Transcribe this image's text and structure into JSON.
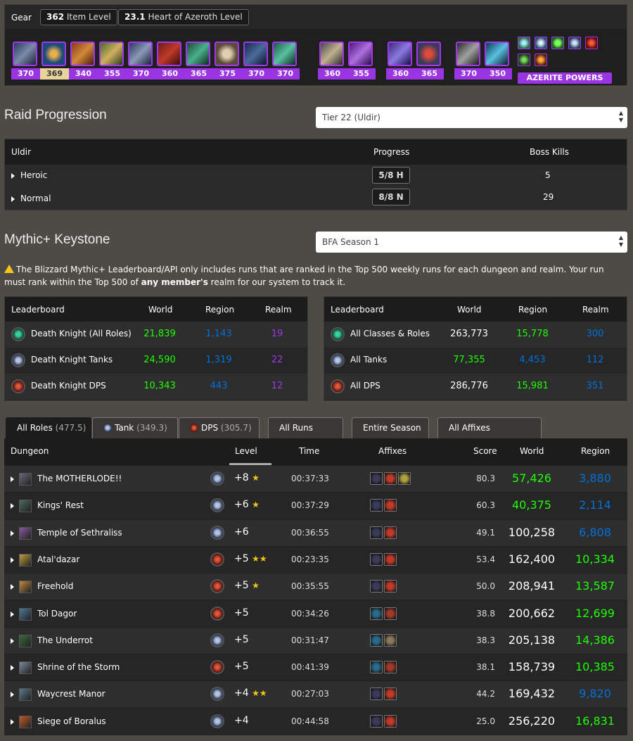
{
  "gear": {
    "title": "Gear",
    "item_level_value": "362",
    "item_level_label": "Item Level",
    "heart_value": "23.1",
    "heart_label": "Heart of Azeroth Level",
    "item_levels_group1": [
      "370",
      "369",
      "340",
      "355",
      "370",
      "360",
      "365",
      "375",
      "370",
      "370"
    ],
    "item_levels_group2": [
      "360",
      "355"
    ],
    "item_levels_group3": [
      "360",
      "365"
    ],
    "item_levels_group4": [
      "370",
      "350"
    ],
    "azerite_label": "AZERITE POWERS"
  },
  "raid": {
    "title": "Raid Progression",
    "select_value": "Tier 22 (Uldir)",
    "columns": [
      "Uldir",
      "Progress",
      "Boss Kills"
    ],
    "rows": [
      {
        "difficulty": "Heroic",
        "progress": "5/8 H",
        "kills": "5"
      },
      {
        "difficulty": "Normal",
        "progress": "8/8 N",
        "kills": "29"
      }
    ]
  },
  "mythic": {
    "title": "Mythic+ Keystone",
    "select_value": "BFA Season 1",
    "notice_a": "The Blizzard Mythic+ Leaderboard/API only includes runs that are ranked in the Top 500 weekly runs for each dungeon and realm. Your run must rank within the Top 500 of ",
    "notice_bold": "any member's",
    "notice_b": " realm for our system to track it."
  },
  "leaderboard_left": {
    "columns": [
      "Leaderboard",
      "World",
      "Region",
      "Realm"
    ],
    "rows": [
      {
        "name": "Death Knight (All Roles)",
        "world": "21,839",
        "region": "1,143",
        "realm": "19"
      },
      {
        "name": "Death Knight Tanks",
        "world": "24,590",
        "region": "1,319",
        "realm": "22"
      },
      {
        "name": "Death Knight DPS",
        "world": "10,343",
        "region": "443",
        "realm": "12"
      }
    ]
  },
  "leaderboard_right": {
    "columns": [
      "Leaderboard",
      "World",
      "Region",
      "Realm"
    ],
    "rows": [
      {
        "name": "All Classes & Roles",
        "world": "263,773",
        "region": "15,778",
        "realm": "300"
      },
      {
        "name": "All Tanks",
        "world": "77,355",
        "region": "4,453",
        "realm": "112"
      },
      {
        "name": "All DPS",
        "world": "286,776",
        "region": "15,981",
        "realm": "351"
      }
    ]
  },
  "tabs": [
    {
      "label": "All Roles",
      "sub": "(477.5)"
    },
    {
      "label": "Tank",
      "sub": "(349.3)"
    },
    {
      "label": "DPS",
      "sub": "(305.7)"
    },
    {
      "label": "All Runs",
      "sub": ""
    },
    {
      "label": "Entire Season",
      "sub": ""
    },
    {
      "label": "All Affixes",
      "sub": ""
    }
  ],
  "runs": {
    "columns": [
      "Dungeon",
      "Level",
      "Time",
      "Affixes",
      "Score",
      "World",
      "Region"
    ],
    "rows": [
      {
        "dungeon": "The MOTHERLODE!!",
        "level": "+8",
        "stars": "★",
        "time": "00:37:33",
        "score": "80.3",
        "world": "57,426",
        "region": "3,880"
      },
      {
        "dungeon": "Kings' Rest",
        "level": "+6",
        "stars": "★",
        "time": "00:37:29",
        "score": "60.3",
        "world": "40,375",
        "region": "2,114"
      },
      {
        "dungeon": "Temple of Sethraliss",
        "level": "+6",
        "stars": "",
        "time": "00:36:55",
        "score": "49.1",
        "world": "100,258",
        "region": "6,808"
      },
      {
        "dungeon": "Atal'dazar",
        "level": "+5",
        "stars": "★★",
        "time": "00:23:35",
        "score": "53.4",
        "world": "162,400",
        "region": "10,334"
      },
      {
        "dungeon": "Freehold",
        "level": "+5",
        "stars": "★",
        "time": "00:35:55",
        "score": "50.0",
        "world": "208,941",
        "region": "13,587"
      },
      {
        "dungeon": "Tol Dagor",
        "level": "+5",
        "stars": "",
        "time": "00:34:26",
        "score": "38.8",
        "world": "200,662",
        "region": "12,699"
      },
      {
        "dungeon": "The Underrot",
        "level": "+5",
        "stars": "",
        "time": "00:31:47",
        "score": "38.3",
        "world": "205,138",
        "region": "14,386"
      },
      {
        "dungeon": "Shrine of the Storm",
        "level": "+5",
        "stars": "",
        "time": "00:41:39",
        "score": "38.1",
        "world": "158,739",
        "region": "10,385"
      },
      {
        "dungeon": "Waycrest Manor",
        "level": "+4",
        "stars": "★★",
        "time": "00:27:03",
        "score": "44.2",
        "world": "169,432",
        "region": "9,820"
      },
      {
        "dungeon": "Siege of Boralus",
        "level": "+4",
        "stars": "",
        "time": "00:44:58",
        "score": "25.0",
        "world": "256,220",
        "region": "16,831"
      }
    ]
  }
}
